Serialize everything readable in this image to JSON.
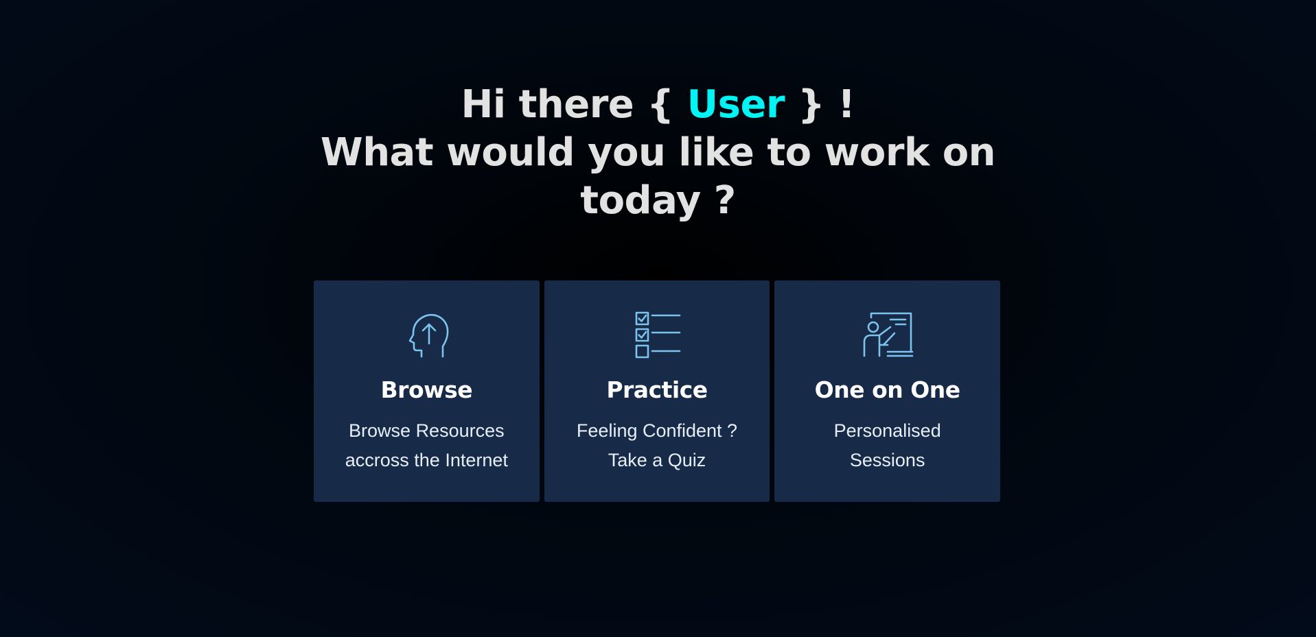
{
  "greeting": {
    "prefix": "Hi there { ",
    "user": "User",
    "suffix": " } !",
    "line2": "What would you like to work on",
    "line3": "today ?"
  },
  "colors": {
    "background": "#01070f",
    "card": "#172a47",
    "accent": "#00f4f4",
    "icon": "#7cc4ee",
    "text": "#e2e2e2"
  },
  "cards": [
    {
      "icon": "head-arrow-up-icon",
      "title": "Browse",
      "desc_line1": "Browse Resources",
      "desc_line2": "accross the Internet"
    },
    {
      "icon": "checklist-icon",
      "title": "Practice",
      "desc_line1": "Feeling Confident ?",
      "desc_line2": "Take a Quiz"
    },
    {
      "icon": "presentation-board-icon",
      "title": "One on One",
      "desc_line1": "Personalised",
      "desc_line2": "Sessions"
    }
  ]
}
